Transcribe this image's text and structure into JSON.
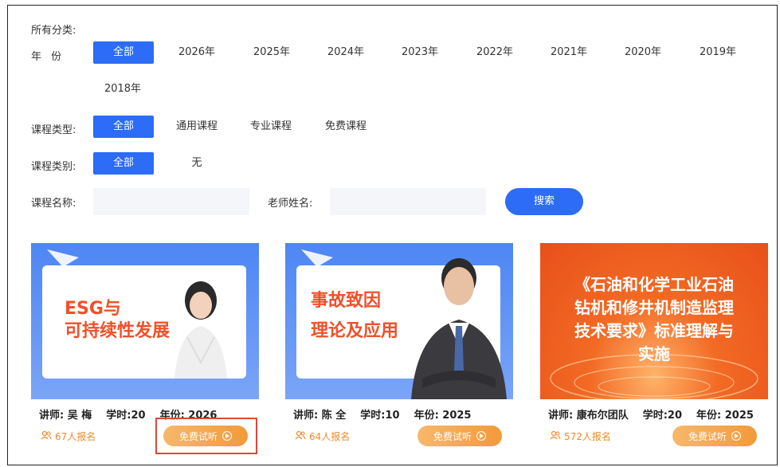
{
  "filters": {
    "category_label": "所有分类:",
    "year_label": "年  份",
    "years": [
      "全部",
      "2026年",
      "2025年",
      "2024年",
      "2023年",
      "2022年",
      "2021年",
      "2020年",
      "2019年",
      "2018年"
    ],
    "type_label": "课程类型:",
    "types": [
      "全部",
      "通用课程",
      "专业课程",
      "免费课程"
    ],
    "class_label": "课程类别:",
    "classes": [
      "全部",
      "无"
    ],
    "course_name_label": "课程名称:",
    "teacher_name_label": "老师姓名:",
    "course_name_value": "",
    "teacher_name_value": "",
    "search_label": "搜索"
  },
  "courses": [
    {
      "thumb_line1": "ESG与",
      "thumb_line2": "可持续性发展",
      "teacher": "讲师: 吴  梅",
      "hours": "学时:20",
      "year": "年份: 2026",
      "enrolled": "67人报名",
      "trial": "免费试听"
    },
    {
      "thumb_line1": "事故致因",
      "thumb_line2": "理论及应用",
      "teacher": "讲师: 陈  全",
      "hours": "学时:10",
      "year": "年份: 2025",
      "enrolled": "64人报名",
      "trial": "免费试听"
    },
    {
      "thumb_line1": "《石油和化学工业石油",
      "thumb_line2": "钻机和修井机制造监理",
      "thumb_line3": "技术要求》标准理解与",
      "thumb_line4": "实施",
      "teacher": "讲师: 康布尔团队",
      "hours": "学时:20",
      "year": "年份: 2025",
      "enrolled": "572人报名",
      "trial": "免费试听"
    }
  ],
  "colors": {
    "accent": "#2c6cf6",
    "trial_orange": "#f29a3a",
    "highlight_red": "#e0463a"
  }
}
